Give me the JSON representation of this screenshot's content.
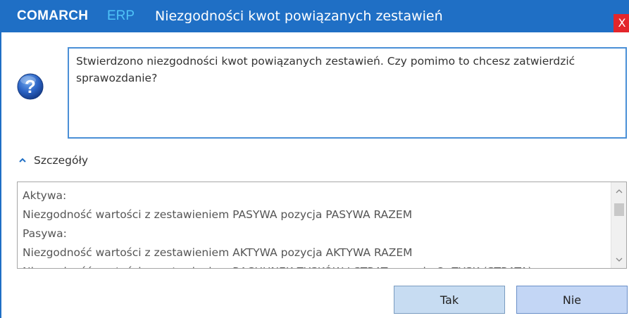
{
  "titlebar": {
    "brand": "COMARCH",
    "brand_erp": "ERP",
    "title": "Niezgodności kwot powiązanych zestawień",
    "close_label": "X",
    "color": "#1f6fc5",
    "close_color": "#e3262b"
  },
  "message": {
    "icon": "question-icon",
    "text": "Stwierdzono niezgodności kwot powiązanych zestawień. Czy pomimo to chcesz zatwierdzić sprawozdanie?"
  },
  "details": {
    "toggle_label": "Szczegóły",
    "toggle_icon": "chevron-up-icon",
    "lines": [
      "Aktywa:",
      "Niezgodność wartości z zestawieniem PASYWA pozycja PASYWA RAZEM",
      "Pasywa:",
      "Niezgodność wartości z zestawieniem AKTYWA pozycja AKTYWA RAZEM",
      "Niezgodność wartości z zestawieniem RACHUNEK ZYSKÓW I STRAT pozycja O. ZYSK (STRATA)"
    ]
  },
  "buttons": {
    "yes_label": "Tak",
    "no_label": "Nie"
  }
}
